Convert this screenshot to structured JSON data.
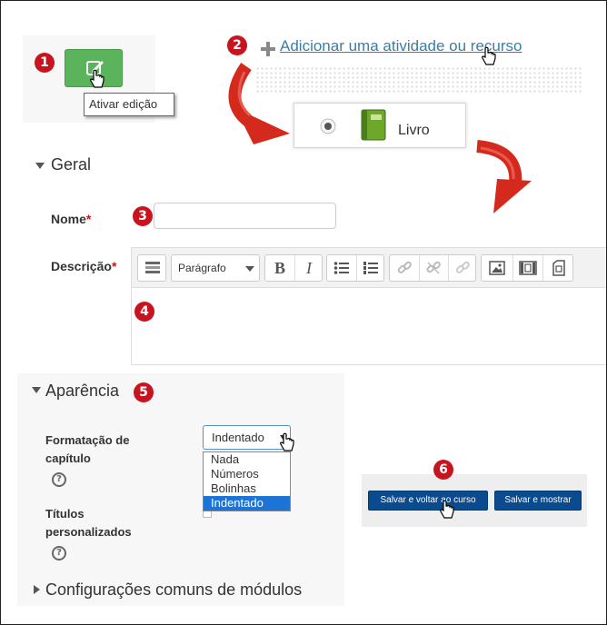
{
  "steps": [
    "1",
    "2",
    "3",
    "4",
    "5",
    "6"
  ],
  "edit_button": {
    "tooltip": "Ativar edição"
  },
  "add_activity": {
    "label": "Adicionar uma atividade ou recurso"
  },
  "activity_option": {
    "label": "Livro"
  },
  "geral": {
    "title": "Geral"
  },
  "nome": {
    "label": "Nome",
    "required": "*",
    "value": ""
  },
  "descricao": {
    "label": "Descrição",
    "required": "*",
    "format_select": "Parágrafo",
    "bold": "B",
    "italic": "I"
  },
  "aparencia": {
    "title": "Aparência",
    "formatacao_label_line1": "Formatação de",
    "formatacao_label_line2": "capítulo",
    "selected": "Indentado",
    "options": [
      "Nada",
      "Números",
      "Bolinhas",
      "Indentado"
    ],
    "titulos_label_line1": "Títulos",
    "titulos_label_line2": "personalizados",
    "help_glyph": "?"
  },
  "config_comuns": {
    "title": "Configurações comuns de módulos"
  },
  "buttons": {
    "save_return": "Salvar e voltar ao curso",
    "save_show": "Salvar e mostrar"
  },
  "colors": {
    "badge": "#c8141e",
    "edit_button": "#5bb35b",
    "link": "#3a7ea6",
    "primary_button": "#0a4b8f",
    "arrow": "#d42a1e",
    "dropdown_selected": "#1e73d6"
  },
  "icons": [
    "edit-icon",
    "hand-cursor-icon",
    "plus-icon",
    "radio-icon",
    "book-icon",
    "curved-arrow-icon",
    "toggle-toolbar-icon",
    "bullet-list-icon",
    "numbered-list-icon",
    "link-icon",
    "unlink-icon",
    "image-icon",
    "media-icon",
    "help-icon"
  ]
}
